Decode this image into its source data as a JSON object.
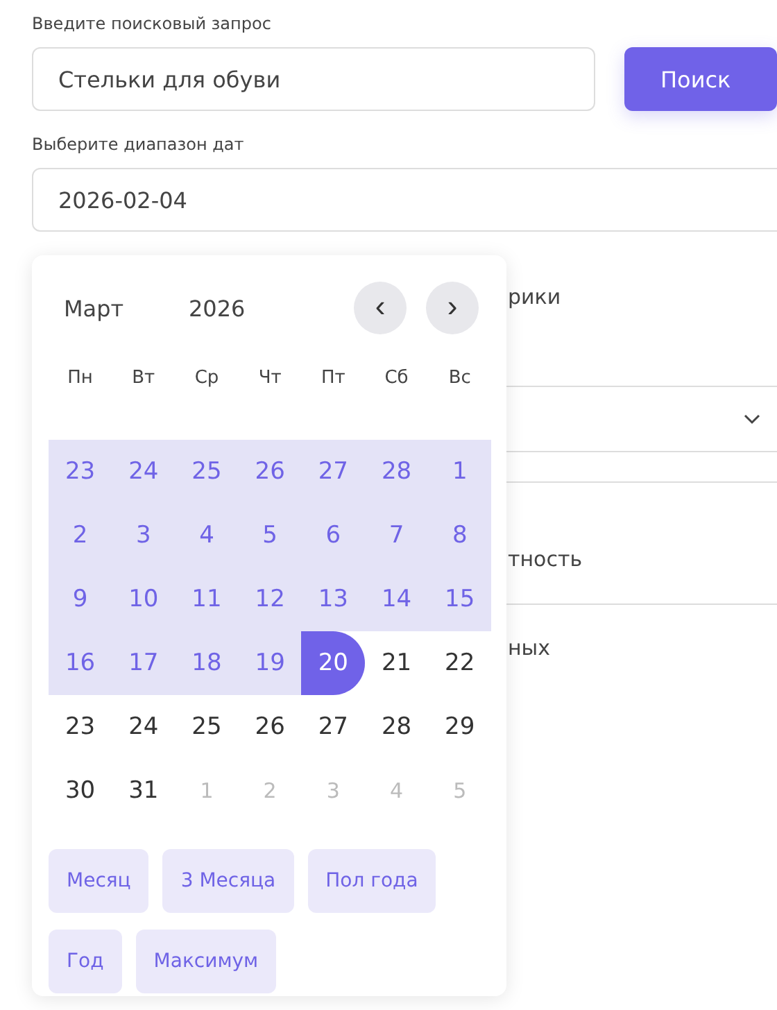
{
  "search": {
    "label": "Введите поисковый запрос",
    "value": "Стельки для обуви",
    "button": "Поиск"
  },
  "date_range": {
    "label": "Выберите диапазон дат",
    "value": "2026-02-04"
  },
  "background": {
    "text_1": "рики",
    "text_2": "тность",
    "text_3": "ных"
  },
  "calendar": {
    "month": "Март",
    "year": "2026",
    "prev": "‹",
    "next": "›",
    "weekdays": [
      "Пн",
      "Вт",
      "Ср",
      "Чт",
      "Пт",
      "Сб",
      "Вс"
    ],
    "days": [
      {
        "label": "23",
        "in_range": true,
        "selected": false,
        "outside": false
      },
      {
        "label": "24",
        "in_range": true,
        "selected": false,
        "outside": false
      },
      {
        "label": "25",
        "in_range": true,
        "selected": false,
        "outside": false
      },
      {
        "label": "26",
        "in_range": true,
        "selected": false,
        "outside": false
      },
      {
        "label": "27",
        "in_range": true,
        "selected": false,
        "outside": false
      },
      {
        "label": "28",
        "in_range": true,
        "selected": false,
        "outside": false
      },
      {
        "label": "1",
        "in_range": true,
        "selected": false,
        "outside": false
      },
      {
        "label": "2",
        "in_range": true,
        "selected": false,
        "outside": false
      },
      {
        "label": "3",
        "in_range": true,
        "selected": false,
        "outside": false
      },
      {
        "label": "4",
        "in_range": true,
        "selected": false,
        "outside": false
      },
      {
        "label": "5",
        "in_range": true,
        "selected": false,
        "outside": false
      },
      {
        "label": "6",
        "in_range": true,
        "selected": false,
        "outside": false
      },
      {
        "label": "7",
        "in_range": true,
        "selected": false,
        "outside": false
      },
      {
        "label": "8",
        "in_range": true,
        "selected": false,
        "outside": false
      },
      {
        "label": "9",
        "in_range": true,
        "selected": false,
        "outside": false
      },
      {
        "label": "10",
        "in_range": true,
        "selected": false,
        "outside": false
      },
      {
        "label": "11",
        "in_range": true,
        "selected": false,
        "outside": false
      },
      {
        "label": "12",
        "in_range": true,
        "selected": false,
        "outside": false
      },
      {
        "label": "13",
        "in_range": true,
        "selected": false,
        "outside": false
      },
      {
        "label": "14",
        "in_range": true,
        "selected": false,
        "outside": false
      },
      {
        "label": "15",
        "in_range": true,
        "selected": false,
        "outside": false
      },
      {
        "label": "16",
        "in_range": true,
        "selected": false,
        "outside": false
      },
      {
        "label": "17",
        "in_range": true,
        "selected": false,
        "outside": false
      },
      {
        "label": "18",
        "in_range": true,
        "selected": false,
        "outside": false
      },
      {
        "label": "19",
        "in_range": true,
        "selected": false,
        "outside": false
      },
      {
        "label": "20",
        "in_range": false,
        "selected": true,
        "outside": false
      },
      {
        "label": "21",
        "in_range": false,
        "selected": false,
        "outside": false
      },
      {
        "label": "22",
        "in_range": false,
        "selected": false,
        "outside": false
      },
      {
        "label": "23",
        "in_range": false,
        "selected": false,
        "outside": false
      },
      {
        "label": "24",
        "in_range": false,
        "selected": false,
        "outside": false
      },
      {
        "label": "25",
        "in_range": false,
        "selected": false,
        "outside": false
      },
      {
        "label": "26",
        "in_range": false,
        "selected": false,
        "outside": false
      },
      {
        "label": "27",
        "in_range": false,
        "selected": false,
        "outside": false
      },
      {
        "label": "28",
        "in_range": false,
        "selected": false,
        "outside": false
      },
      {
        "label": "29",
        "in_range": false,
        "selected": false,
        "outside": false
      },
      {
        "label": "30",
        "in_range": false,
        "selected": false,
        "outside": false
      },
      {
        "label": "31",
        "in_range": false,
        "selected": false,
        "outside": false
      },
      {
        "label": "1",
        "in_range": false,
        "selected": false,
        "outside": true
      },
      {
        "label": "2",
        "in_range": false,
        "selected": false,
        "outside": true
      },
      {
        "label": "3",
        "in_range": false,
        "selected": false,
        "outside": true
      },
      {
        "label": "4",
        "in_range": false,
        "selected": false,
        "outside": true
      },
      {
        "label": "5",
        "in_range": false,
        "selected": false,
        "outside": true
      }
    ],
    "presets": [
      "Месяц",
      "3 Месяца",
      "Пол года",
      "Год",
      "Максимум"
    ]
  }
}
